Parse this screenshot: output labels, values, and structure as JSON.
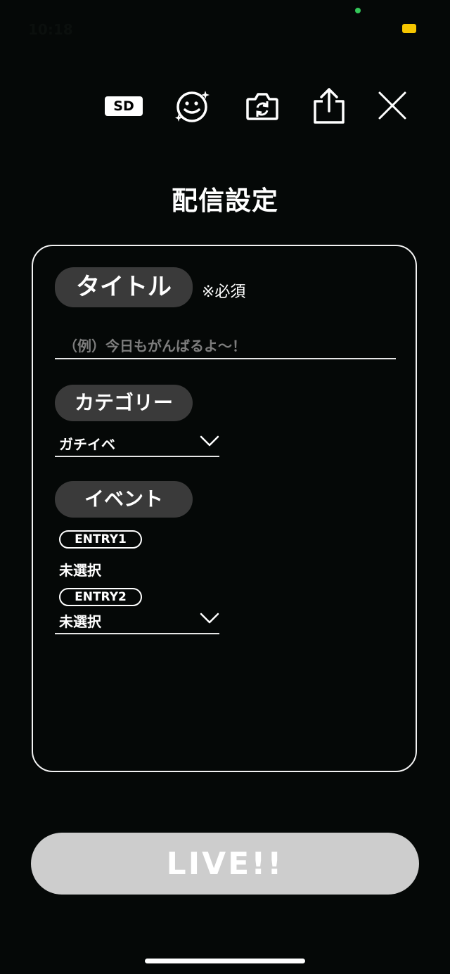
{
  "status_bar": {
    "time": "10:18"
  },
  "toolbar": {
    "quality_label": "SD",
    "icons": [
      "face-filter-icon",
      "camera-switch-icon",
      "share-icon",
      "close-icon"
    ]
  },
  "heading": "配信設定",
  "form": {
    "title_section": {
      "label": "タイトル",
      "required_note": "※必須",
      "placeholder": "（例）今日もがんばるよ〜！"
    },
    "category_section": {
      "label": "カテゴリー",
      "selected": "ガチイベ"
    },
    "event_section": {
      "label": "イベント",
      "entry1": {
        "label": "ENTRY1",
        "value": "未選択"
      },
      "entry2": {
        "label": "ENTRY2",
        "value": "未選択"
      }
    }
  },
  "live_button": {
    "label": "LIVE!!"
  },
  "colors": {
    "background": "#050807",
    "pill": "#3a3a3a",
    "live_button": "#cdcdcd"
  }
}
